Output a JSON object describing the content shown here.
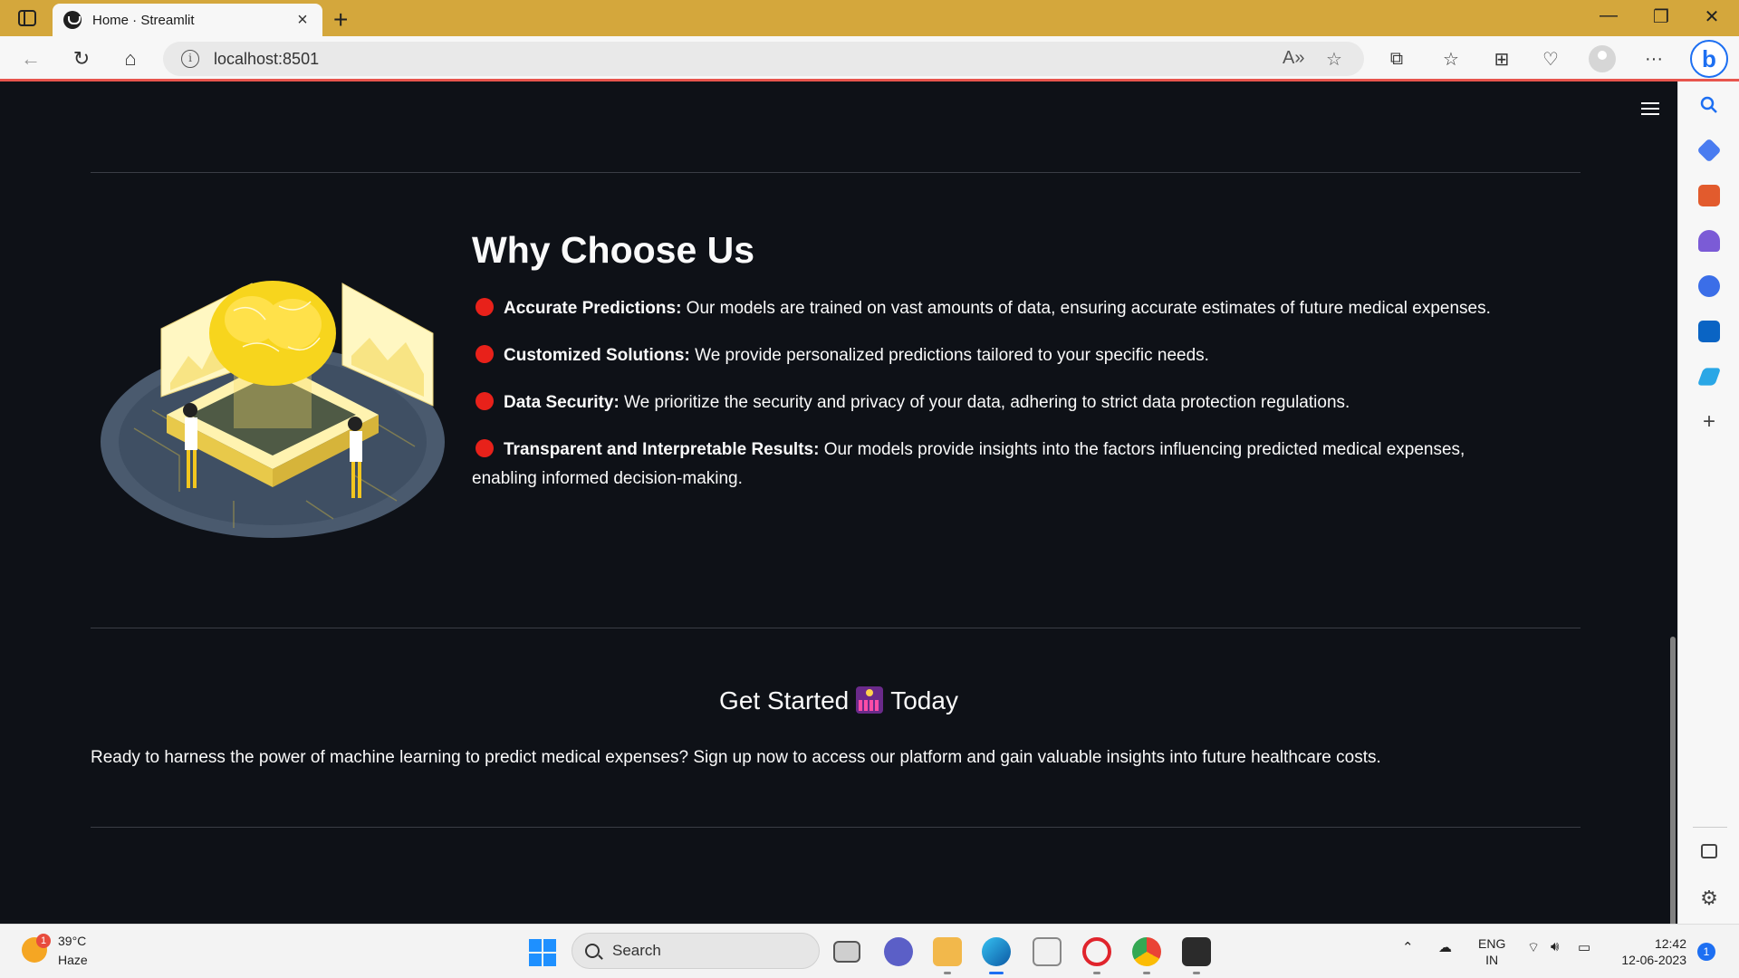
{
  "browser": {
    "tab_title": "Home · Streamlit",
    "url": "localhost:8501",
    "new_tab_label": "+",
    "close_tab_label": "×"
  },
  "page": {
    "why_title": "Why Choose Us",
    "features": [
      {
        "title": "Accurate Predictions:",
        "text": " Our models are trained on vast amounts of data, ensuring accurate estimates of future medical expenses."
      },
      {
        "title": "Customized Solutions:",
        "text": " We provide personalized predictions tailored to your specific needs."
      },
      {
        "title": "Data Security:",
        "text": " We prioritize the security and privacy of your data, adhering to strict data protection regulations."
      },
      {
        "title": "Transparent and Interpretable Results:",
        "text": " Our models provide insights into the factors influencing predicted medical expenses, enabling informed decision-making."
      }
    ],
    "get_started_before": "Get Started",
    "get_started_after": "Today",
    "get_started_text": "Ready to harness the power of machine learning to predict medical expenses? Sign up now to access our platform and gain valuable insights into future healthcare costs."
  },
  "taskbar": {
    "weather_temp": "39°C",
    "weather_cond": "Haze",
    "weather_badge": "1",
    "search_label": "Search",
    "lang_line1": "ENG",
    "lang_line2": "IN",
    "time": "12:42",
    "date": "12-06-2023",
    "notification_count": "1"
  },
  "colors": {
    "tabbar": "#d4a73c",
    "content_bg": "#0e1117",
    "bullet": "#e8211a"
  }
}
